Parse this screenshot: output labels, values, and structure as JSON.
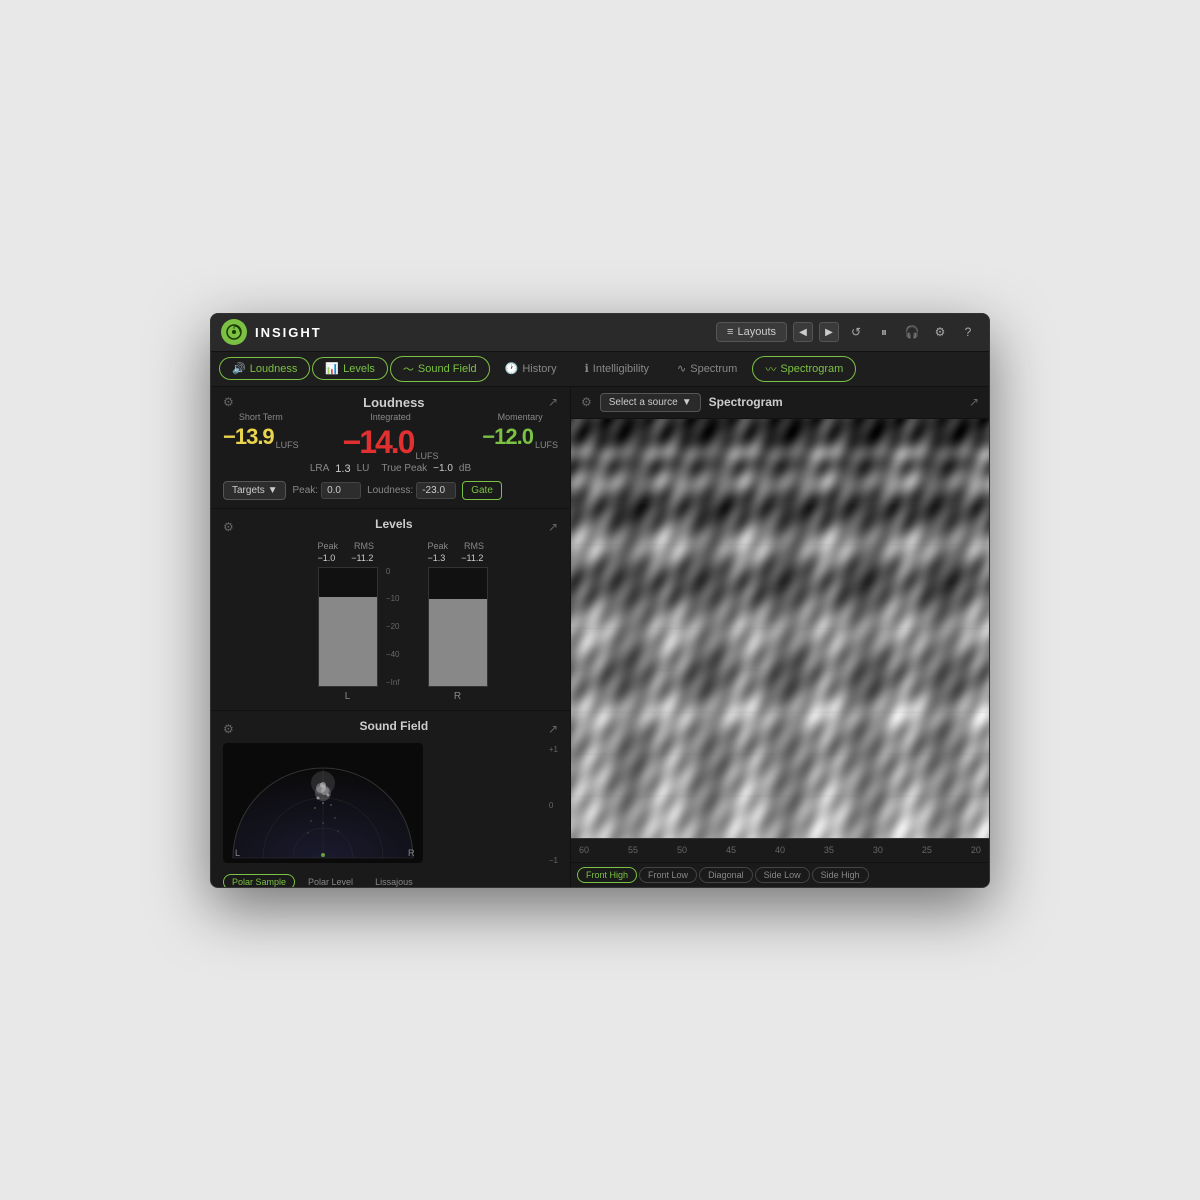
{
  "app": {
    "title": "INSIGHT",
    "layouts_label": "Layouts",
    "tabs": [
      {
        "label": "Loudness",
        "icon": "speaker",
        "active": true
      },
      {
        "label": "Levels",
        "icon": "bar-chart",
        "active": true
      },
      {
        "label": "Sound Field",
        "icon": "wave",
        "active": true
      },
      {
        "label": "History",
        "icon": "clock",
        "active": false
      },
      {
        "label": "Intelligibility",
        "icon": "circle-i",
        "active": false
      },
      {
        "label": "Spectrum",
        "icon": "spectrum",
        "active": false
      },
      {
        "label": "Spectrogram",
        "icon": "spectrogram",
        "active": true
      }
    ]
  },
  "loudness": {
    "title": "Loudness",
    "short_term_label": "Short Term",
    "integrated_label": "Integrated",
    "momentary_label": "Momentary",
    "short_term_value": "−13.9",
    "integrated_value": "−14.0",
    "momentary_value": "−12.0",
    "lufs_label": "LUFS",
    "lra_label": "LRA",
    "lra_value": "1.3",
    "lu_label": "LU",
    "true_peak_label": "True Peak",
    "true_peak_value": "−1.0",
    "db_label": "dB",
    "targets_label": "Targets",
    "peak_label": "Peak:",
    "peak_value": "0.0",
    "loudness_label": "Loudness:",
    "loudness_value": "−23.0",
    "gate_label": "Gate"
  },
  "levels": {
    "title": "Levels",
    "left_peak": "−1.0",
    "left_rms": "−11.2",
    "right_peak": "−1.3",
    "right_rms": "−11.2",
    "scale": [
      "0",
      "−10",
      "−20",
      "−40",
      "−Inf"
    ],
    "channel_l": "L",
    "channel_r": "R"
  },
  "soundfield": {
    "title": "Sound Field",
    "scale": [
      "+1",
      "0",
      "−1"
    ],
    "channel_l": "L",
    "channel_r": "R",
    "tabs": [
      "Polar Sample",
      "Polar Level",
      "Lissajous"
    ]
  },
  "spectrogram": {
    "source_label": "Select a source",
    "title": "Spectrogram",
    "time_labels": [
      "60",
      "55",
      "50",
      "45",
      "40",
      "35",
      "30",
      "25",
      "20"
    ],
    "footer_tabs": [
      "Front High",
      "Front Low",
      "Diagonal",
      "Side Low",
      "Side High"
    ]
  },
  "colors": {
    "accent_green": "#7bc143",
    "text_yellow": "#e8d44d",
    "text_red": "#e03030",
    "text_green": "#7bc143",
    "bg_dark": "#1a1a1a",
    "bg_darker": "#111111"
  }
}
